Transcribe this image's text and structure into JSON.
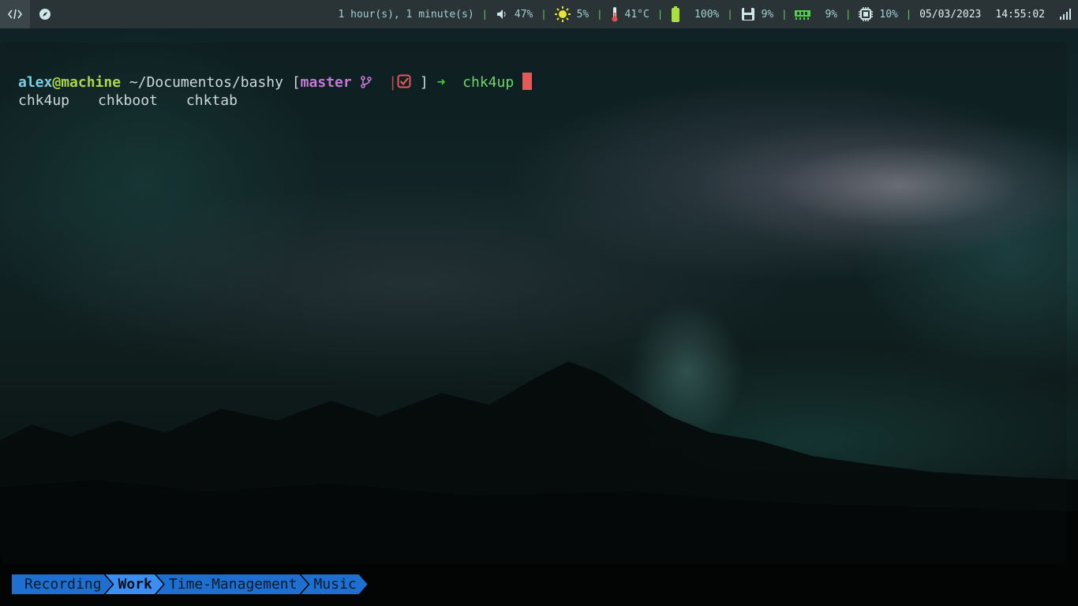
{
  "topbar": {
    "left_icons": [
      "code-icon",
      "compass-icon"
    ],
    "uptime": "1 hour(s), 1 minute(s)",
    "volume": "47%",
    "brightness": "5%",
    "temperature": "41°C",
    "battery": "100%",
    "disk": "9%",
    "memory": "9%",
    "cpu": "10%",
    "date": "05/03/2023",
    "time": "14:55:02",
    "separator": "|",
    "colors": {
      "accent": "#5fd35a",
      "background": "#2a3437"
    }
  },
  "terminal": {
    "user": "alex",
    "host": "@machine",
    "path": "~/Documentos/bashy",
    "open_bracket": "[",
    "branch": "master",
    "pipe": "|",
    "close_bracket": "]",
    "arrow": "➜",
    "command": "chk4up",
    "completions": [
      "chk4up",
      "chkboot",
      "chktab"
    ]
  },
  "workspaces": {
    "items": [
      {
        "label": "Recording",
        "active": false
      },
      {
        "label": "Work",
        "active": true
      },
      {
        "label": "Time-Management",
        "active": false
      },
      {
        "label": "Music",
        "active": false
      }
    ]
  }
}
